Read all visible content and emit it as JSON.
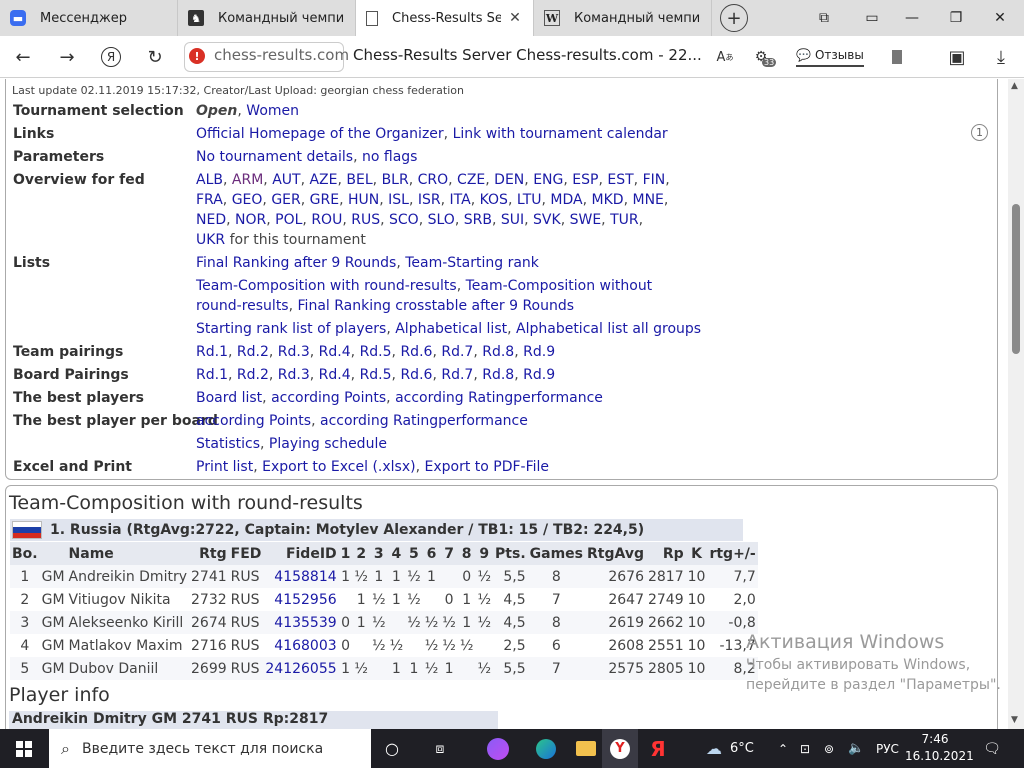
{
  "tabs": [
    {
      "label": "Мессенджер",
      "icon": "messenger-icon",
      "active": false
    },
    {
      "label": "Командный чемпиона",
      "icon": "chess-icon",
      "active": false
    },
    {
      "label": "Chess-Results Server",
      "icon": "document-icon",
      "active": true
    },
    {
      "label": "Командный чемпиона",
      "icon": "wikipedia-icon",
      "active": false
    }
  ],
  "toolbar": {
    "domain": "chess-results.com",
    "page_title": "Chess-Results Server Chess-results.com - 22...",
    "reviews_label": "Отзывы",
    "badge_count": "33"
  },
  "page": {
    "last_update": "Last update 02.11.2019 15:17:32, Creator/Last Upload: georgian chess federation",
    "rows": {
      "tournament_selection": {
        "label": "Tournament selection",
        "open": "Open",
        "women": "Women"
      },
      "links": {
        "label": "Links",
        "items": [
          "Official Homepage of the Organizer",
          "Link with tournament calendar"
        ]
      },
      "parameters": {
        "label": "Parameters",
        "items": [
          "No tournament details",
          "no flags"
        ]
      },
      "overview": {
        "label": "Overview for fed",
        "feds": [
          "ALB",
          "ARM",
          "AUT",
          "AZE",
          "BEL",
          "BLR",
          "CRO",
          "CZE",
          "DEN",
          "ENG",
          "ESP",
          "EST",
          "FIN",
          "FRA",
          "GEO",
          "GER",
          "GRE",
          "HUN",
          "ISL",
          "ISR",
          "ITA",
          "KOS",
          "LTU",
          "MDA",
          "MKD",
          "MNE",
          "NED",
          "NOR",
          "POL",
          "ROU",
          "RUS",
          "SCO",
          "SLO",
          "SRB",
          "SUI",
          "SVK",
          "SWE",
          "TUR",
          "UKR"
        ],
        "suffix": "for this tournament"
      },
      "lists": {
        "label": "Lists",
        "line1": [
          "Final Ranking after 9 Rounds",
          "Team-Starting rank"
        ],
        "line2": [
          "Team-Composition with round-results",
          "Team-Composition without round-results",
          "Final Ranking crosstable after 9 Rounds"
        ],
        "line3": [
          "Starting rank list of players",
          "Alphabetical list",
          "Alphabetical list all groups"
        ]
      },
      "team_pairings": {
        "label": "Team pairings",
        "items": [
          "Rd.1",
          "Rd.2",
          "Rd.3",
          "Rd.4",
          "Rd.5",
          "Rd.6",
          "Rd.7",
          "Rd.8",
          "Rd.9"
        ]
      },
      "board_pairings": {
        "label": "Board Pairings",
        "items": [
          "Rd.1",
          "Rd.2",
          "Rd.3",
          "Rd.4",
          "Rd.5",
          "Rd.6",
          "Rd.7",
          "Rd.8",
          "Rd.9"
        ]
      },
      "best_players": {
        "label": "The best players",
        "items": [
          "Board list",
          "according Points",
          "according Ratingperformance"
        ]
      },
      "best_per_board": {
        "label": "The best player per board",
        "items": [
          "according Points",
          "according Ratingperformance"
        ]
      },
      "stats": {
        "items": [
          "Statistics",
          "Playing schedule"
        ]
      },
      "excel": {
        "label": "Excel and Print",
        "items": [
          "Print list",
          "Export to Excel (.xlsx)",
          "Export to PDF-File"
        ]
      }
    },
    "composition_title": "Team-Composition with round-results",
    "team_header": "1. Russia (RtgAvg:2722, Captain: Motylev Alexander / TB1: 15 / TB2: 224,5)",
    "flag_colors": [
      "#ffffff",
      "#1c3fa8",
      "#d52b1e"
    ],
    "table": {
      "headers": [
        "Bo.",
        "",
        "Name",
        "Rtg",
        "FED",
        "FideID",
        "1",
        "2",
        "3",
        "4",
        "5",
        "6",
        "7",
        "8",
        "9",
        "Pts.",
        "Games",
        "RtgAvg",
        "Rp",
        "K",
        "rtg+/-"
      ],
      "rows": [
        [
          "1",
          "GM",
          "Andreikin Dmitry",
          "2741",
          "RUS",
          "4158814",
          "1",
          "½",
          "1",
          "1",
          "½",
          "1",
          "",
          "0",
          "½",
          "5,5",
          "8",
          "2676",
          "2817",
          "10",
          "7,7"
        ],
        [
          "2",
          "GM",
          "Vitiugov Nikita",
          "2732",
          "RUS",
          "4152956",
          "",
          "1",
          "½",
          "1",
          "½",
          "",
          "0",
          "1",
          "½",
          "4,5",
          "7",
          "2647",
          "2749",
          "10",
          "2,0"
        ],
        [
          "3",
          "GM",
          "Alekseenko Kirill",
          "2674",
          "RUS",
          "4135539",
          "0",
          "1",
          "½",
          "",
          "½",
          "½",
          "½",
          "1",
          "½",
          "4,5",
          "8",
          "2619",
          "2662",
          "10",
          "-0,8"
        ],
        [
          "4",
          "GM",
          "Matlakov Maxim",
          "2716",
          "RUS",
          "4168003",
          "0",
          "",
          "½",
          "½",
          "",
          "½",
          "½",
          "½",
          "",
          "2,5",
          "6",
          "2608",
          "2551",
          "10",
          "-13,7"
        ],
        [
          "5",
          "GM",
          "Dubov Daniil",
          "2699",
          "RUS",
          "24126055",
          "1",
          "½",
          "",
          "1",
          "1",
          "½",
          "1",
          "",
          "½",
          "5,5",
          "7",
          "2575",
          "2805",
          "10",
          "8,2"
        ]
      ]
    },
    "player_info_title": "Player info",
    "player_bar": "Andreikin Dmitry GM 2741 RUS Rp:2817"
  },
  "activation": {
    "title": "Активация Windows",
    "line1": "Чтобы активировать Windows,",
    "line2": "перейдите в раздел \"Параметры\"."
  },
  "taskbar": {
    "search_placeholder": "Введите здесь текст для поиска",
    "temperature": "6°C",
    "lang": "РУС",
    "time": "7:46",
    "date": "16.10.2021"
  }
}
